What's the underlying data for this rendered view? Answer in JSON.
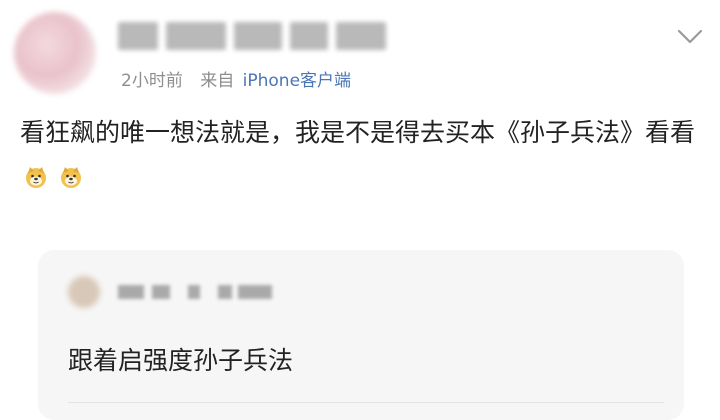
{
  "post": {
    "meta": {
      "time": "2小时前",
      "source_label": "来自",
      "source": "iPhone客户端"
    },
    "text": "看狂飙的唯一想法就是，我是不是得去买本《孙子兵法》看看",
    "emojis": [
      "doge-icon",
      "doge-icon"
    ]
  },
  "comment": {
    "text": "跟着启强度孙子兵法"
  },
  "colors": {
    "meta_gray": "#8e8e8e",
    "link_blue": "#4a76b5",
    "body_text": "#222222",
    "card_bg": "#f6f6f6",
    "doge_yellow": "#f2c14e"
  }
}
